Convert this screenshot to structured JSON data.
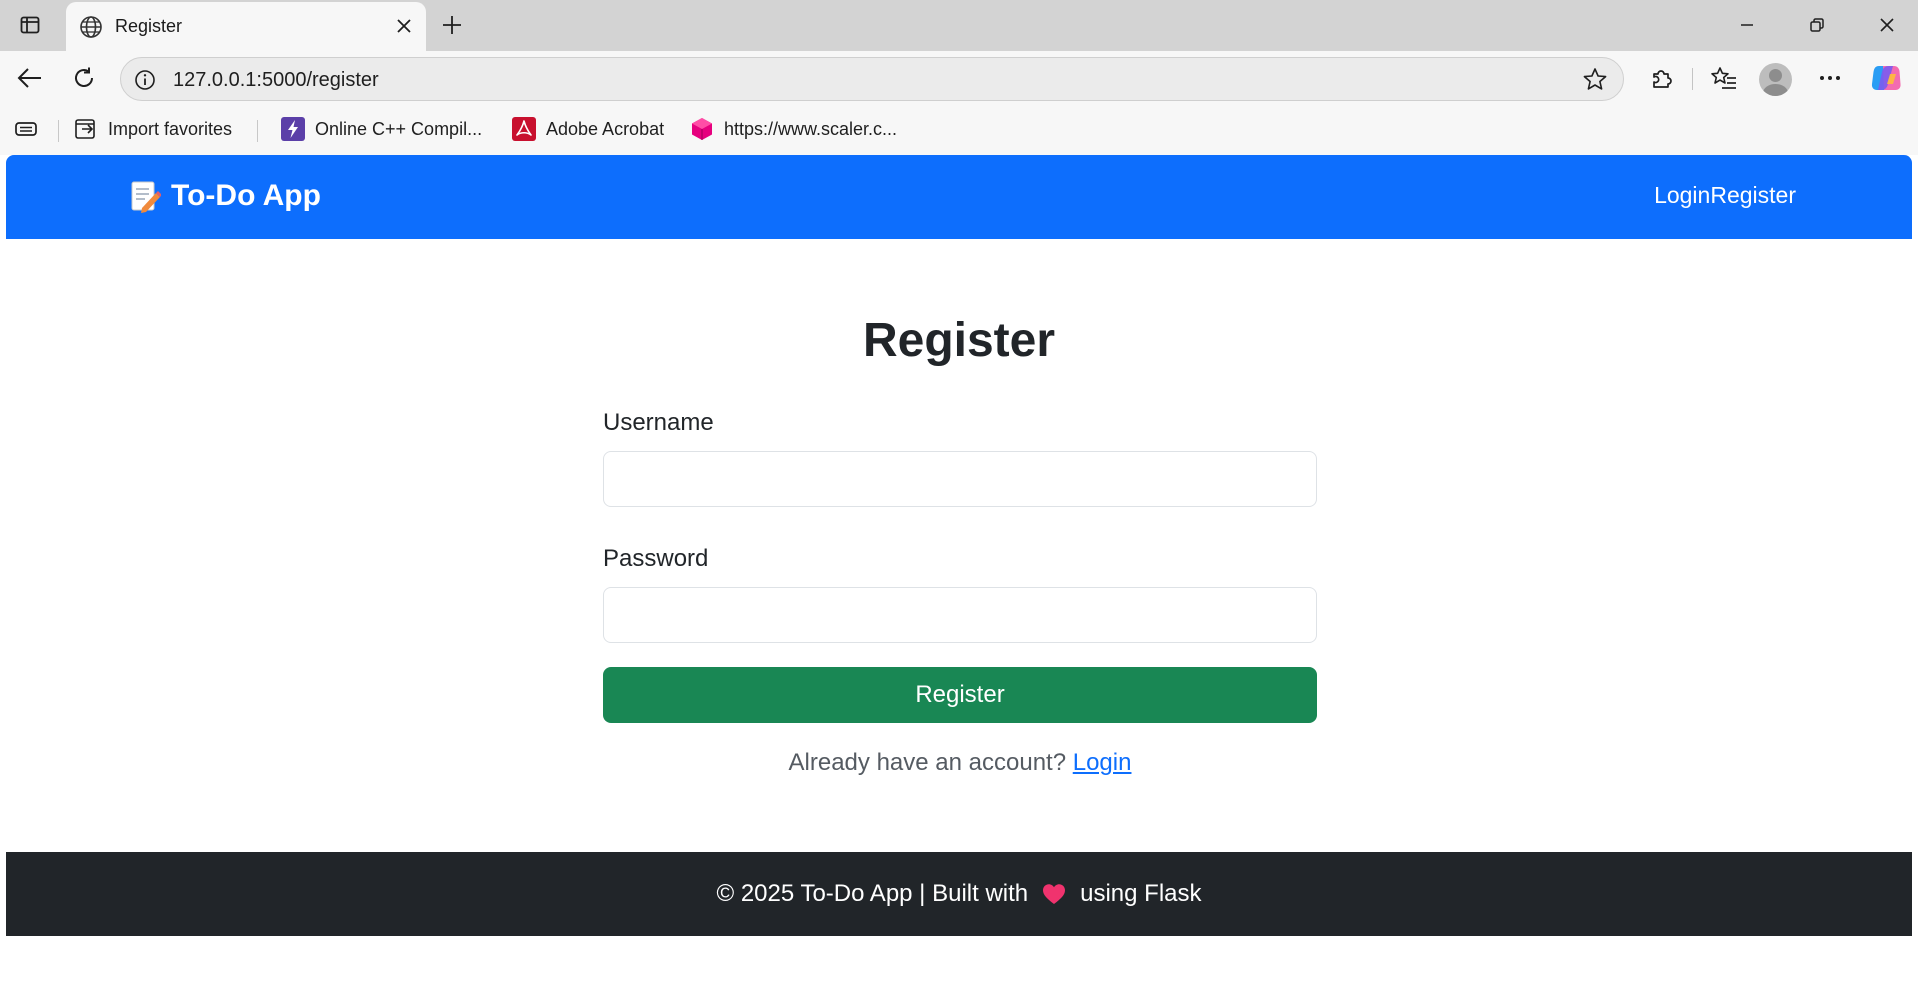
{
  "browser": {
    "tab": {
      "title": "Register",
      "icon": "globe-icon"
    },
    "address_bar": {
      "url": "127.0.0.1:5000/register"
    },
    "bookmarks": [
      {
        "label": "Import favorites",
        "icon": "import-favorites-icon"
      },
      {
        "label": "Online C++ Compil...",
        "icon": "lightning-favicon"
      },
      {
        "label": "Adobe Acrobat",
        "icon": "adobe-acrobat-favicon"
      },
      {
        "label": "https://www.scaler.c...",
        "icon": "scaler-favicon"
      }
    ]
  },
  "site": {
    "brand": {
      "name": "To-Do App",
      "icon": "memo-icon"
    },
    "nav": {
      "login": "Login",
      "register": "Register"
    }
  },
  "page": {
    "title": "Register",
    "form": {
      "username_label": "Username",
      "username_value": "",
      "password_label": "Password",
      "password_value": "",
      "submit_label": "Register"
    },
    "already_text": "Already have an account?",
    "login_link": "Login"
  },
  "footer": {
    "before": "© 2025 To-Do App | Built with",
    "after": "using Flask",
    "icon": "heart-icon"
  },
  "colors": {
    "navbar": "#0d6efd",
    "submit_button": "#198754",
    "footer": "#212529",
    "link": "#0d6efd"
  }
}
